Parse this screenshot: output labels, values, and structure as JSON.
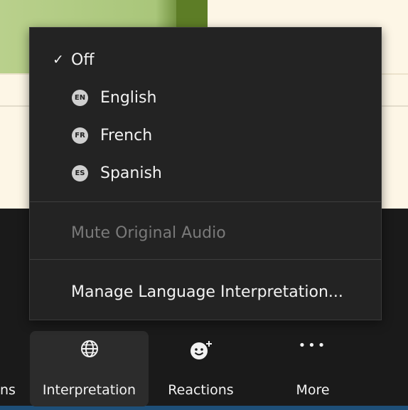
{
  "menu": {
    "check_glyph": "✓",
    "items": [
      {
        "label": "Off"
      },
      {
        "badge": "EN",
        "label": "English"
      },
      {
        "badge": "FR",
        "label": "French"
      },
      {
        "badge": "ES",
        "label": "Spanish"
      }
    ],
    "mute_label": "Mute Original Audio",
    "manage_label": "Manage Language Interpretation..."
  },
  "toolbar": {
    "cut_label": "ns",
    "interpretation_label": "Interpretation",
    "reactions_label": "Reactions",
    "more_label": "More",
    "more_glyph": "•••"
  },
  "icons": {
    "interpretation": "globe-icon",
    "reactions": "smiley-plus-icon",
    "more": "ellipsis-icon",
    "selected": "checkmark-icon"
  },
  "colors": {
    "menu_bg": "#232323",
    "toolbar_bg": "#1a1a1a",
    "text": "#f2f2f2",
    "disabled_text": "#7a7a7a",
    "badge_bg": "#cfcfcf"
  }
}
